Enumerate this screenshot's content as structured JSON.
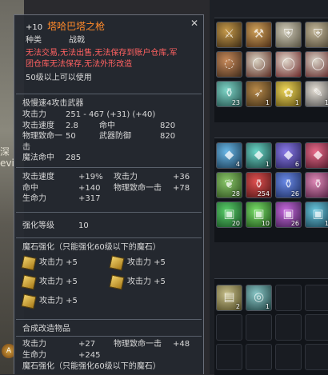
{
  "item": {
    "enhance": "+10",
    "name": "塔哈巴塔之枪",
    "category_label": "种类",
    "category_value": "战戟",
    "restrictions": [
      "无法交易,无法出售,无法保存到账户仓库,军",
      "团仓库无法保存,无法外形改造"
    ],
    "level_req": "50级以上可以使用",
    "weapon_type": "极慢速4攻击武器",
    "base_stats": [
      {
        "k1": "攻击力",
        "v1": "251 - 467 (+31) (+40)",
        "k2": "",
        "v2": ""
      },
      {
        "k1": "攻击速度",
        "v1": "2.8",
        "k2": "命中",
        "v2": "820"
      },
      {
        "k1": "物理致命一击",
        "v1": "50",
        "k2": "武器防御",
        "v2": "820"
      },
      {
        "k1": "魔法命中",
        "v1": "285",
        "k2": "",
        "v2": ""
      }
    ],
    "bonus_stats": [
      {
        "k1": "攻击速度",
        "v1": "+19%",
        "k2": "攻击力",
        "v2": "+36"
      },
      {
        "k1": "命中",
        "v1": "+140",
        "k2": "物理致命一击",
        "v2": "+78"
      },
      {
        "k1": "生命力",
        "v1": "+317",
        "k2": "",
        "v2": ""
      }
    ],
    "enhance_level_label": "强化等级",
    "enhance_level_value": "10",
    "manastone_header": "魔石强化（只能强化60级以下的魔石）",
    "manastones": [
      "攻击力 +5",
      "攻击力 +5",
      "攻击力 +5",
      "攻击力 +5",
      "攻击力 +5"
    ],
    "fusion_header": "合成改造物品",
    "fusion_stats": [
      {
        "k1": "攻击力",
        "v1": "+27",
        "k2": "物理致命一击",
        "v2": "+48"
      },
      {
        "k1": "生命力",
        "v1": "+245",
        "k2": "",
        "v2": ""
      }
    ],
    "fusion_manastone_header": "魔石强化（只能强化60级以下的魔石）"
  },
  "world": {
    "lines": [
      "深",
      "evi"
    ],
    "badge": "A"
  },
  "inventory": {
    "grid1": [
      {
        "icon": "spear-icon",
        "c1": "#c79a4a",
        "c2": "#3a2a14",
        "count": ""
      },
      {
        "icon": "axe-icon",
        "c1": "#d1a25a",
        "c2": "#4a2b14",
        "count": ""
      },
      {
        "icon": "armor-icon",
        "c1": "#cfcab8",
        "c2": "#55503f",
        "count": ""
      },
      {
        "icon": "armor-icon",
        "c1": "#c4b89a",
        "c2": "#4b4332",
        "count": ""
      },
      {
        "icon": "necklace-icon",
        "c1": "#c88a5a",
        "c2": "#3e2a1a",
        "count": ""
      },
      {
        "icon": "ring-icon",
        "c1": "#d9d2c2",
        "c2": "#5a2a20",
        "count": ""
      },
      {
        "icon": "ring-icon",
        "c1": "#e0d8cc",
        "c2": "#6a2626",
        "count": ""
      },
      {
        "icon": "ring-icon",
        "c1": "#d8d2c6",
        "c2": "#5e2424",
        "count": ""
      },
      {
        "icon": "potion-icon",
        "c1": "#7fd6c8",
        "c2": "#1f4a46",
        "count": "23"
      },
      {
        "icon": "bow-icon",
        "c1": "#b88a4a",
        "c2": "#3a2a14",
        "count": "1"
      },
      {
        "icon": "flower-icon",
        "c1": "#f0d85a",
        "c2": "#5a4a10",
        "count": "1"
      },
      {
        "icon": "feather-icon",
        "c1": "#e6e0d6",
        "c2": "#4a4a4a",
        "count": "1"
      }
    ],
    "grid2": [
      {
        "icon": "crystal-icon",
        "c1": "#6ab8e8",
        "c2": "#16364e",
        "count": "4"
      },
      {
        "icon": "crystal-icon",
        "c1": "#6ad6c8",
        "c2": "#173e3a",
        "count": "1"
      },
      {
        "icon": "crystal-icon",
        "c1": "#8a7ae8",
        "c2": "#25205a",
        "count": "6"
      },
      {
        "icon": "crystal-icon",
        "c1": "#e86a8a",
        "c2": "#4a1626",
        "count": ""
      },
      {
        "icon": "herb-icon",
        "c1": "#8ac86a",
        "c2": "#2a4a1a",
        "count": "28"
      },
      {
        "icon": "potion-icon",
        "c1": "#e05050",
        "c2": "#4a1414",
        "count": "254"
      },
      {
        "icon": "potion-icon",
        "c1": "#6a8ae8",
        "c2": "#1a2a5a",
        "count": "26"
      },
      {
        "icon": "potion-icon",
        "c1": "#e08ab8",
        "c2": "#4a1a3a",
        "count": ""
      },
      {
        "icon": "scroll-icon",
        "c1": "#5ad06a",
        "c2": "#154a20",
        "count": "20"
      },
      {
        "icon": "scroll-icon",
        "c1": "#7ae06a",
        "c2": "#1a4a14",
        "count": "10"
      },
      {
        "icon": "scroll-icon",
        "c1": "#c86ae0",
        "c2": "#3a1a4a",
        "count": "26"
      },
      {
        "icon": "scroll-icon",
        "c1": "#6ac8e0",
        "c2": "#143a4a",
        "count": "1"
      }
    ],
    "grid3": [
      {
        "icon": "chest-icon",
        "c1": "#c8c08a",
        "c2": "#4a4420",
        "count": "2"
      },
      {
        "icon": "bracelet-icon",
        "c1": "#8ac8c8",
        "c2": "#1a3a3a",
        "count": "1"
      }
    ]
  }
}
